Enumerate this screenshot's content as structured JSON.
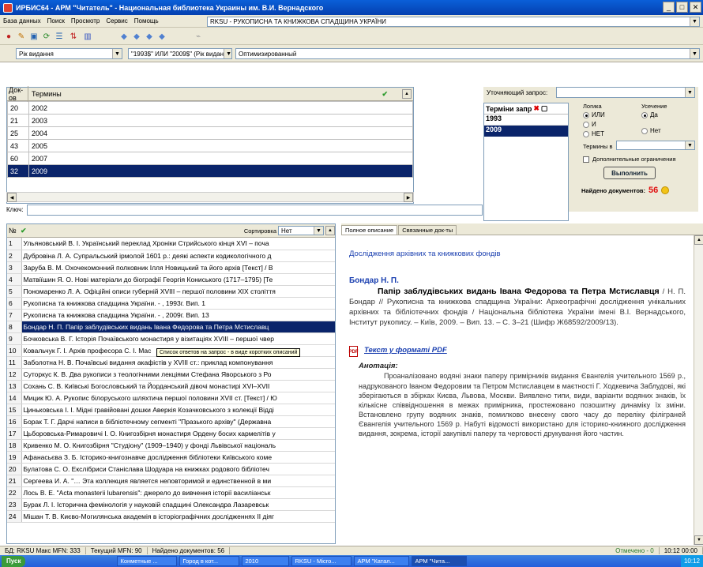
{
  "window": {
    "title": "ИРБИС64 - АРМ \"Читатель\" - Национальная библиотека Украины им. В.И. Вернадского"
  },
  "menu": [
    "База данных",
    "Поиск",
    "Просмотр",
    "Сервис",
    "Помощь"
  ],
  "db_combo": "RKSU - РУКОПИСНА ТА КНИЖКОВА СПАДЩИНА УКРАЇНИ",
  "query_bar": {
    "field": "Рік видання",
    "expression": "\"1993$\" ИЛИ \"2009$\" (Рік видан",
    "mode": "Оптимизированный"
  },
  "terms": {
    "header_docs": "Док-ов",
    "header_terms": "Термины",
    "rows": [
      {
        "count": "20",
        "term": "2002"
      },
      {
        "count": "21",
        "term": "2003"
      },
      {
        "count": "25",
        "term": "2004"
      },
      {
        "count": "43",
        "term": "2005"
      },
      {
        "count": "60",
        "term": "2007"
      },
      {
        "count": "32",
        "term": "2009"
      }
    ],
    "key_label": "Ключ:"
  },
  "query_panel": {
    "label": "Терміни запр",
    "items": [
      "1993",
      "2009"
    ]
  },
  "refine": {
    "label": "Уточняющий запрос:",
    "logic_title": "Логика",
    "logic": [
      "ИЛИ",
      "И",
      "НЕТ"
    ],
    "trunc_title": "Усечение",
    "trunc": [
      "Да",
      "Нет"
    ],
    "terms_in": "Термины в",
    "extra": "Дополнительные ограничения",
    "run": "Выполнить",
    "found_label": "Найдено документов:",
    "found_value": "56"
  },
  "results": {
    "header_no": "№",
    "sort_label": "Сортировка",
    "sort_value": "Нет",
    "tooltip": "Список ответов на запрос - в виде коротких описаний",
    "rows": [
      "Ульяновський В. І. Український переклад Хроніки Стрийського кінця XVI – поча",
      "Дубровіна Л. А. Супральський ірмолой 1601 р.: деякі аспекти кодикологічного д",
      "Заруба В. М. Охочекомонний полковник Ілля Новицький та його архів [Текст] / В",
      "Матвіїшин Я. О. Нові матеріали до біографії Георгія Кониського (1717–1795) [Те",
      "Пономаренко Л. А. Офіційні описи губерній XVIII – першої половини XIX століття",
      "Рукописна та книжкова спадщина України. - , 1993г. Вип. 1",
      "Рукописна та книжкова спадщина України. - , 2009г. Вип. 13",
      "Бондар Н. П. Папір заблудівських видань Івана Федорова та Петра Мстиславц",
      "Бочковська В. Г. Історія Почаївського монастиря у візитаціях XVIII – першої чвер",
      "Ковальчук Г. І. Архів професора С. І. Мас",
      "Заболотна Н. В. Почаївські видання акафістів у XVIII ст.: приклад компонування",
      "Суторкус К. В. Два рукописи з теологічними лекціями Стефана Яворського з Ро",
      "Сохань С. В. Київські Богословський та Йорданський дівочі монастирі XVI–XVII",
      "Мицик Ю. А. Рукопис білоруського шляхтича першої половини XVII ст. [Текст] / Ю",
      "Циньковська І. І. Мідні гравійовані дошки Аверкія Козачковського з колекції Відді",
      "Борак Т. Г. Дарчі написи в бібліотечному сегменті \"Празького архіву\" (Державна",
      "Цьборовська-Римаровичі І. О. Книгозбірня монастиря Ордену босих кармелітів у",
      "Кривенко М. О. Книгозбірня \"Студіону\" (1909–1940) у фонді Львівської національ",
      "Афанасьєва З. Б. Історико-книгознавче дослідження бібліотеки Київського коме",
      "Булатова С. О. Екслібриси Станіслава Шодуара на книжках родового бібліотеч",
      "Сергеева И. А. \"… Эта коллекция является неповторимой и единственной в ми",
      "Лось В. Е. \"Acta monasterii lubarensis\": джерело до вивчення історії василіанськ",
      "Бурак Л. І. Історична фемінологія у науковій спадщині Олександра Лазаревськ",
      "Мішан Т. В. Києво-Могилянська академія в історіографічних дослідженнях ІІ діяг"
    ]
  },
  "detail": {
    "tab1": "Полное описание",
    "tab2": "Связанные док-ты",
    "section": "Дослідження архівних та книжкових фондів",
    "author": "Бондар Н. П.",
    "title_bold": "Папір заблудівських видань Івана Федорова та Петра Мстиславця",
    "body": " / Н. П. Бондар // Рукописна та книжкова спадщина України: Археографічні дослідження унікальних архівних та бібліотечних фондів / Національна бібліотека України імені В.І. Вернадського, Інститут рукопису. – Київ, 2009. – Вип. 13. – С. 3–21 (Шифр Ж68592/2009/13).",
    "pdf_link": "Текст у форматі PDF",
    "annot_label": "Анотація:",
    "annot": "Проаналізовано водяні знаки паперу примірників видання Євангелія учительного 1569 р., надрукованого Іваном Федоровим та Петром Мстиславцем в маєтності Г. Ходкевича Заблудові, які зберігаються в збірках Києва, Львова, Москви. Виявлено типи, види, варіанти водяних знаків, їх кількісне співвідношення в межах примірника, простежовано позошитну динаміку їх зміни. Встановлено групу водяних знаків, помилково внесену свого часу до переліку філіграней Євангелія учительного 1569 р. Набуті відомості використано для історико-книжного дослідження видання, зокрема, історії закупівлі паперу та черговості друкування його частин."
  },
  "status": {
    "db": "БД: RKSU Макс MFN: 333",
    "mfn": "Текущий MFN: 90",
    "found": "Найдено документов: 56",
    "marked": "Отмечено - 0",
    "time": "10:12 00:00"
  },
  "taskbar": {
    "start": "Пуск",
    "tasks": [
      "Конметные ...",
      "Город в кот...",
      "2010",
      "RKSU - Micro...",
      "АРМ \"Катал...",
      "АРМ \"Чита..."
    ],
    "clock": "10:12"
  },
  "colors": {
    "selection": "#0a246a",
    "link": "#1a3fb0",
    "found": "#e01010",
    "title_bar": "#0a5fd8"
  }
}
